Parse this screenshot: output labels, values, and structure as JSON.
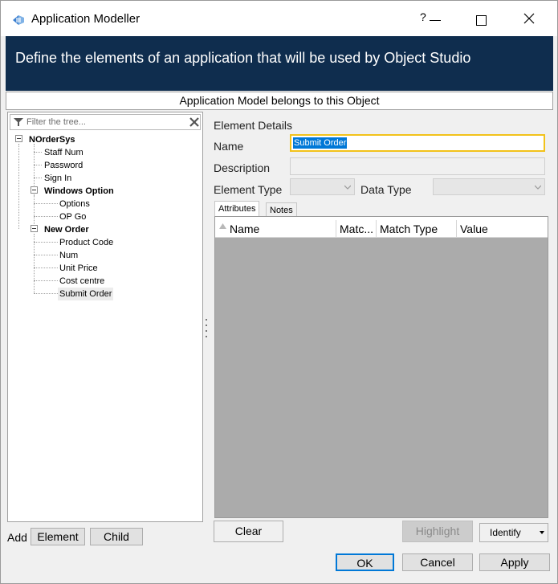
{
  "window": {
    "title": "Application Modeller",
    "help_label": "?"
  },
  "banner": {
    "text": "Define the elements of an application that will be used by Object Studio"
  },
  "belongs_text": "Application Model belongs to this Object",
  "tree": {
    "filter_placeholder": "Filter the tree...",
    "items": [
      {
        "label": "NOrderSys",
        "bold": true,
        "level": 0
      },
      {
        "label": "Staff Num",
        "bold": false,
        "level": 1
      },
      {
        "label": "Password",
        "bold": false,
        "level": 1
      },
      {
        "label": "Sign In",
        "bold": false,
        "level": 1
      },
      {
        "label": "Windows Option",
        "bold": true,
        "level": 1
      },
      {
        "label": "Options",
        "bold": false,
        "level": 2
      },
      {
        "label": "OP Go",
        "bold": false,
        "level": 2
      },
      {
        "label": "New Order",
        "bold": true,
        "level": 1
      },
      {
        "label": "Product Code",
        "bold": false,
        "level": 2
      },
      {
        "label": "Num",
        "bold": false,
        "level": 2
      },
      {
        "label": "Unit Price",
        "bold": false,
        "level": 2
      },
      {
        "label": "Cost centre",
        "bold": false,
        "level": 2
      },
      {
        "label": "Submit Order",
        "bold": false,
        "level": 2,
        "selected": true
      }
    ]
  },
  "add": {
    "label": "Add",
    "element_button": "Element",
    "child_button": "Child"
  },
  "details": {
    "section_title": "Element Details",
    "name_label": "Name",
    "name_value": "Submit Order",
    "description_label": "Description",
    "description_value": "",
    "element_type_label": "Element Type",
    "data_type_label": "Data Type"
  },
  "tabs": {
    "attributes": "Attributes",
    "notes": "Notes"
  },
  "grid": {
    "columns": [
      "Name",
      "Matc...",
      "Match Type",
      "Value"
    ]
  },
  "actions": {
    "clear": "Clear",
    "highlight": "Highlight",
    "identify": "Identify"
  },
  "footer": {
    "ok": "OK",
    "cancel": "Cancel",
    "apply": "Apply"
  },
  "colors": {
    "banner": "#0f2d4e",
    "name_focus_border": "#f2c21a",
    "selection": "#0078d7",
    "grid_body": "#ababab"
  }
}
